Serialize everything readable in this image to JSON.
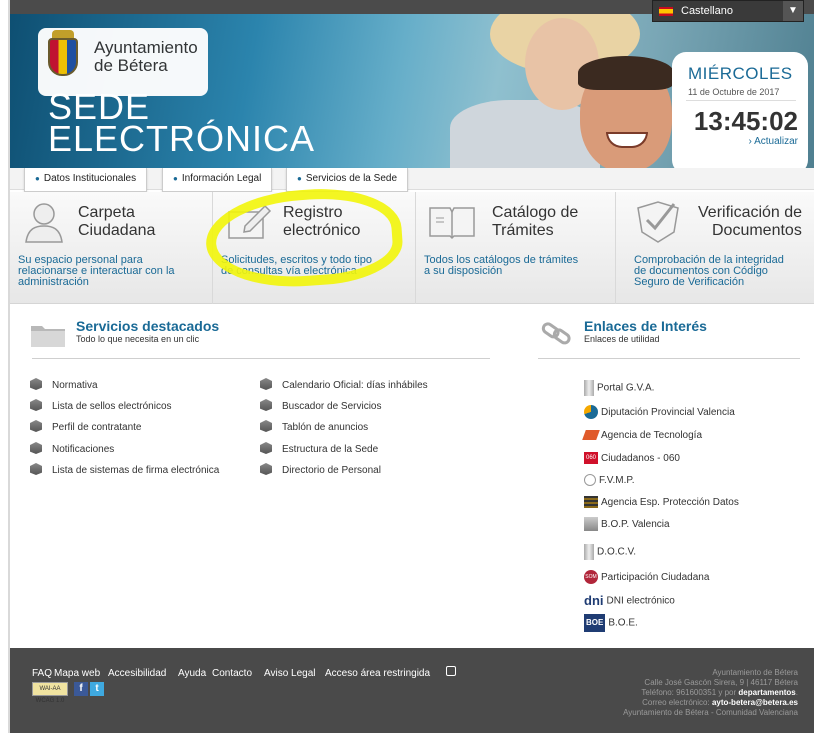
{
  "language": {
    "label": "Castellano"
  },
  "header": {
    "org_line1": "Ayuntamiento",
    "org_line2": "de Bétera",
    "sede_line1": "SEDE",
    "sede_line2": "ELECTRÓNICA",
    "day": "MIÉRCOLES",
    "date": "11 de Octubre de 2017",
    "time": "13:45:02",
    "refresh": "› Actualizar"
  },
  "nav_tabs": [
    "Datos Institucionales",
    "Información Legal",
    "Servicios de la Sede"
  ],
  "services": [
    {
      "title1": "Carpeta",
      "title2": "Ciudadana",
      "desc1": "Su espacio personal para",
      "desc2": "relacionarse e interactuar con la",
      "desc3": "administración",
      "icon": "person-icon"
    },
    {
      "title1": "Registro",
      "title2": "electrónico",
      "desc1": "Solicitudes, escritos y todo tipo",
      "desc2": "de consultas vía electrónica",
      "desc3": "",
      "icon": "pen-paper-icon"
    },
    {
      "title1": "Catálogo de",
      "title2": "Trámites",
      "desc1": "Todos los catálogos de trámites",
      "desc2": "a su disposición",
      "desc3": "",
      "icon": "book-icon"
    },
    {
      "title1": "Verificación de",
      "title2": "Documentos",
      "desc1": "Comprobación de la integridad",
      "desc2": "de documentos con Código",
      "desc3": "Seguro de Verificación",
      "icon": "shield-check-icon"
    }
  ],
  "destacados": {
    "title": "Servicios destacados",
    "subtitle": "Todo lo que necesita en un clic",
    "col1": [
      "Normativa",
      "Lista de sellos electrónicos",
      "Perfil de contratante",
      "Notificaciones",
      "Lista de sistemas de firma electrónica"
    ],
    "col2": [
      "Calendario Oficial: días inhábiles",
      "Buscador de Servicios",
      "Tablón de anuncios",
      "Estructura de la Sede",
      "Directorio de Personal"
    ]
  },
  "enlaces": {
    "title": "Enlaces de Interés",
    "subtitle": "Enlaces de utilidad",
    "items": [
      "Portal G.V.A.",
      "Diputación Provincial Valencia",
      "Agencia de Tecnología",
      "Ciudadanos - 060",
      "F.V.M.P.",
      "Agencia Esp. Protección Datos",
      "B.O.P. Valencia",
      "D.O.C.V.",
      "Participación Ciudadana",
      "DNI electrónico",
      "B.O.E."
    ],
    "badge_060": "060",
    "badge_dni": "dni",
    "badge_boe": "BOE",
    "badge_som": "SOM"
  },
  "footer": {
    "links": [
      "FAQ",
      "Mapa web",
      "Accesibilidad",
      "Ayuda",
      "Contacto",
      "Aviso Legal",
      "Acceso área restringida"
    ],
    "wai": "WAI-AA WCAG 1.0",
    "addr1": "Ayuntamiento de Bétera",
    "addr2": "Calle José Gascón Sirera, 9 | 46117 Bétera",
    "addr3_pre": "Teléfono: 961600351 y por",
    "addr3_bold": "departamentos",
    "addr4_pre": "Correo electrónico:",
    "addr4_bold": "ayto-betera@betera.es",
    "addr5": "Ayuntamiento de Bétera - Comunidad Valenciana"
  },
  "colors": {
    "accent": "#1a6a96",
    "footer_bg": "#4a4a4a",
    "highlight": "#f2f50a"
  }
}
